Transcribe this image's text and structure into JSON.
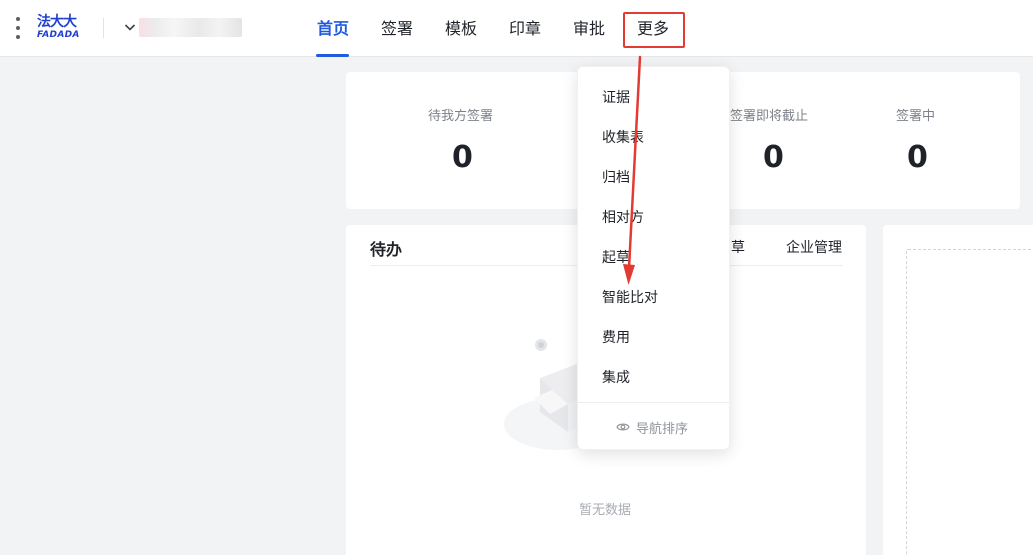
{
  "header": {
    "logo_cn": "法大大",
    "logo_en": "FADADA",
    "nav": [
      {
        "label": "首页",
        "active": true
      },
      {
        "label": "签署",
        "active": false
      },
      {
        "label": "模板",
        "active": false
      },
      {
        "label": "印章",
        "active": false
      },
      {
        "label": "审批",
        "active": false
      },
      {
        "label": "更多",
        "active": false
      }
    ]
  },
  "stats": [
    {
      "label": "待我方签署",
      "value": "0"
    },
    {
      "label": "签署即将截止",
      "value": "0"
    },
    {
      "label": "签署中",
      "value": "0"
    }
  ],
  "todo": {
    "title": "待办",
    "links": [
      "草",
      "企业管理"
    ],
    "empty_text": "暂无数据"
  },
  "more_menu": {
    "items": [
      "证据",
      "收集表",
      "归档",
      "相对方",
      "起草",
      "智能比对",
      "费用",
      "集成"
    ],
    "footer_label": "导航排序"
  },
  "colors": {
    "brand": "#1f5bdc",
    "logo": "#1f3fd1",
    "highlight": "#e23b33"
  }
}
